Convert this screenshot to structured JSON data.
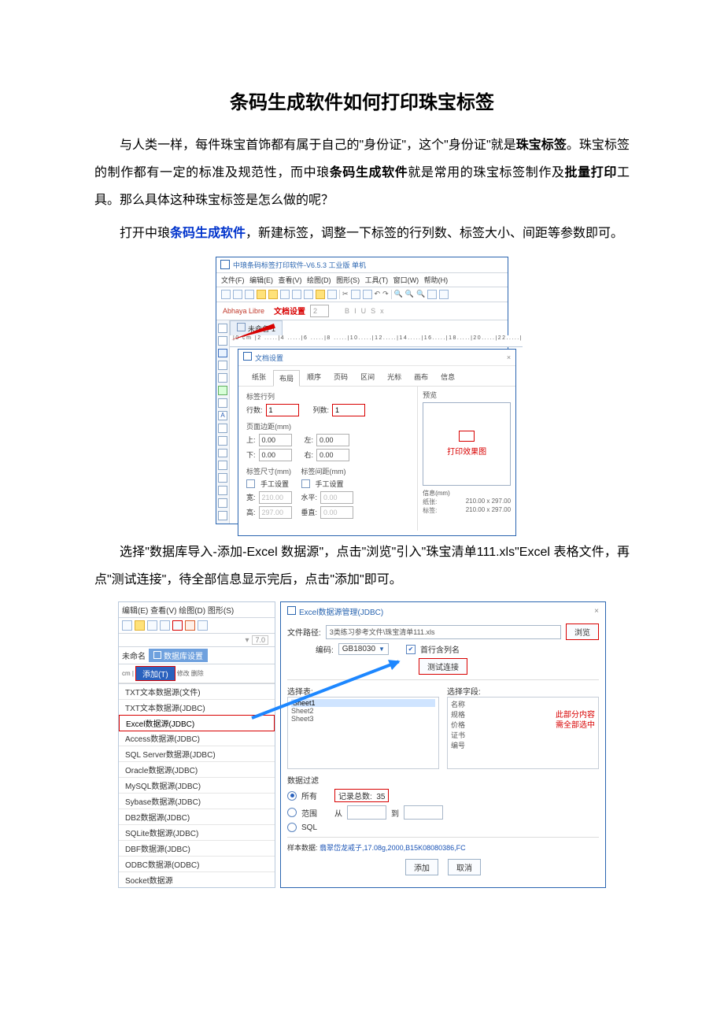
{
  "doc": {
    "title": "条码生成软件如何打印珠宝标签",
    "p1_a": "与人类一样，每件珠宝首饰都有属于自己的\"身份证\"，这个\"身份证\"就是",
    "p1_bold1": "珠宝标签",
    "p1_b": "。珠宝标签的制作都有一定的标准及规范性，而中琅",
    "p1_bold2": "条码生成软件",
    "p1_c": "就是常用的珠宝标签制作及",
    "p1_bold3": "批量打印",
    "p1_d": "工具。那么具体这种珠宝标签是怎么做的呢？",
    "p2_a": "打开中琅",
    "p2_link": "条码生成软件",
    "p2_b": "，新建标签，调整一下标签的行列数、标签大小、间距等参数即可。",
    "p3": "选择\"数据库导入-添加-Excel 数据源\"，点击\"浏览\"引入\"珠宝清单111.xls\"Excel 表格文件，再点\"测试连接\"，待全部信息显示完后，点击\"添加\"即可。"
  },
  "app1": {
    "winTitle": "中琅条码标签打印软件-V6.5.3 工业版 单机",
    "menu": [
      "文件(F)",
      "编辑(E)",
      "查看(V)",
      "绘图(D)",
      "图形(S)",
      "工具(T)",
      "窗口(W)",
      "帮助(H)"
    ],
    "formatFont": "Abhaya Libre",
    "formatHint": "文档设置",
    "formatSize": "2",
    "styleGlyphs": [
      "B",
      "I",
      "U",
      "S",
      "x"
    ],
    "docTab": "未命名-1",
    "ruler": "|0 cm |2 .....|4 .....|6 .....|8 .....|10.....|12.....|14.....|16.....|18.....|20.....|22.....|",
    "dialogTitle": "文档设置",
    "tabs": [
      "纸张",
      "布局",
      "顺序",
      "页码",
      "区间",
      "光标",
      "画布",
      "信息"
    ],
    "activeTab": "布局",
    "group1": "标签行列",
    "rowLabel": "行数:",
    "rowVal": "1",
    "colLabel": "列数:",
    "colVal": "1",
    "group2": "页面边距(mm)",
    "marginTopL": "上:",
    "marginTop": "0.00",
    "marginLeftL": "左:",
    "marginLeft": "0.00",
    "marginBottomL": "下:",
    "marginBottom": "0.00",
    "marginRightL": "右:",
    "marginRight": "0.00",
    "group3a": "标签尺寸(mm)",
    "group3b": "标签间距(mm)",
    "manual": "手工设置",
    "wL": "宽:",
    "wV": "210.00",
    "hL": "高:",
    "hV": "297.00",
    "hpL": "水平:",
    "hpV": "0.00",
    "vpL": "垂直:",
    "vpV": "0.00",
    "previewLabel": "预览",
    "previewNote": "打印效果图",
    "infoLabel": "信息(mm)",
    "paperLabel": "纸张:",
    "paperVal": "210.00 x 297.00",
    "labelLabel": "标签:",
    "labelVal": "210.00 x 297.00"
  },
  "app2": {
    "leftMenu": "编辑(E)  查看(V)  绘图(D)  图形(S)",
    "fontSize": "7.0",
    "docTab": "未命名",
    "dsPanel": "数据库设置",
    "addBtn": "添加(T)",
    "modBtn": "修改",
    "delBtn": "删除",
    "rulerText": "cm  |",
    "dsList": [
      "TXT文本数据源(文件)",
      "TXT文本数据源(JDBC)",
      "Excel数据源(JDBC)",
      "Access数据源(JDBC)",
      "SQL Server数据源(JDBC)",
      "Oracle数据源(JDBC)",
      "MySQL数据源(JDBC)",
      "Sybase数据源(JDBC)",
      "DB2数据源(JDBC)",
      "SQLite数据源(JDBC)",
      "DBF数据源(JDBC)",
      "ODBC数据源(ODBC)",
      "Socket数据源"
    ],
    "dlgTitle": "Excel数据源管理(JDBC)",
    "pathLabel": "文件路径:",
    "pathVal": "3类练习参考文件\\珠宝清单111.xls",
    "browse": "浏览",
    "encLabel": "编码:",
    "encVal": "GB18030",
    "firstRow": "首行含列名",
    "testBtn": "测试连接",
    "tableLabel": "选择表:",
    "fieldLabel": "选择字段:",
    "sheets": [
      "Sheet1",
      "Sheet2",
      "Sheet3"
    ],
    "fields": [
      "名称",
      "规格",
      "价格",
      "证书",
      "编号"
    ],
    "fieldNote1": "此部分内容",
    "fieldNote2": "需全部选中",
    "filterLabel": "数据过滤",
    "optAll": "所有",
    "countLabel": "记录总数:",
    "countVal": "35",
    "optRange": "范围",
    "fromL": "从",
    "toL": "到",
    "optSQL": "SQL",
    "sampleLabel": "样本数据:",
    "sampleVal": "翡翠岱龙戒子,17.08g,2000,B15K08080386,FC",
    "addBtn2": "添加",
    "cancelBtn": "取消"
  }
}
